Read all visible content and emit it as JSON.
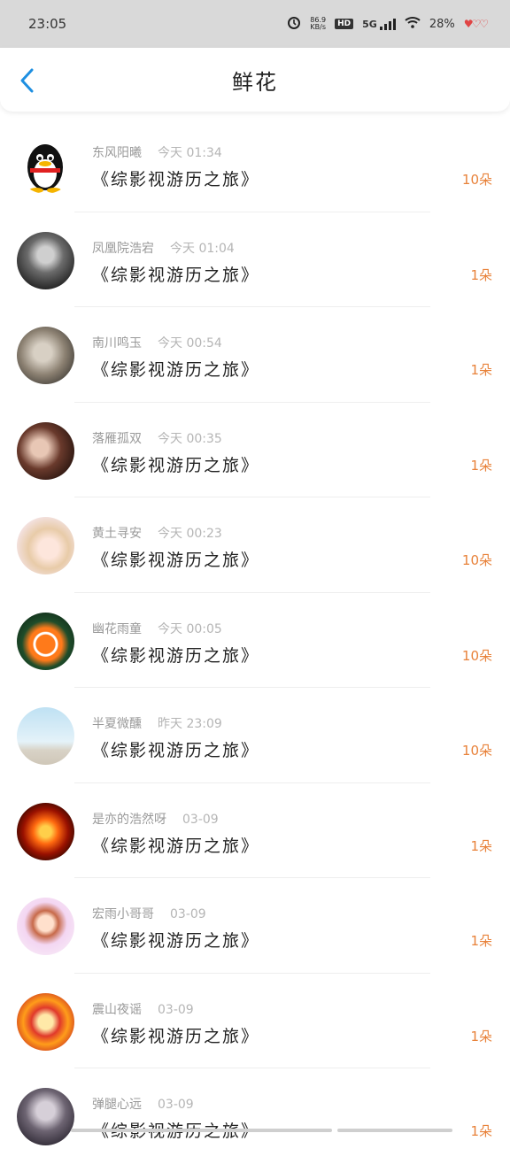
{
  "status": {
    "time": "23:05",
    "net_speed_top": "86.9",
    "net_speed_bottom": "KB/s",
    "hd": "HD",
    "network": "5G",
    "battery": "28%",
    "icons": [
      "alarm-icon",
      "hd-icon",
      "signal-icon",
      "wifi-icon",
      "battery-icon"
    ]
  },
  "header": {
    "title": "鲜花",
    "back_icon": "chevron-left-icon"
  },
  "items": [
    {
      "name": "东风阳曦",
      "time": "今天 01:34",
      "book": "《综影视游历之旅》",
      "count": "10朵"
    },
    {
      "name": "凤凰院浩宕",
      "time": "今天 01:04",
      "book": "《综影视游历之旅》",
      "count": "1朵"
    },
    {
      "name": "南川鸣玉",
      "time": "今天 00:54",
      "book": "《综影视游历之旅》",
      "count": "1朵"
    },
    {
      "name": "落雁孤双",
      "time": "今天 00:35",
      "book": "《综影视游历之旅》",
      "count": "1朵"
    },
    {
      "name": "黄土寻安",
      "time": "今天 00:23",
      "book": "《综影视游历之旅》",
      "count": "10朵"
    },
    {
      "name": "幽花雨童",
      "time": "今天 00:05",
      "book": "《综影视游历之旅》",
      "count": "10朵"
    },
    {
      "name": "半夏微醺",
      "time": "昨天 23:09",
      "book": "《综影视游历之旅》",
      "count": "10朵"
    },
    {
      "name": "是亦的浩然呀",
      "time": "03-09",
      "book": "《综影视游历之旅》",
      "count": "1朵"
    },
    {
      "name": "宏雨小哥哥",
      "time": "03-09",
      "book": "《综影视游历之旅》",
      "count": "1朵"
    },
    {
      "name": "震山夜谣",
      "time": "03-09",
      "book": "《综影视游历之旅》",
      "count": "1朵"
    },
    {
      "name": "弹腿心远",
      "time": "03-09",
      "book": "《综影视游历之旅》",
      "count": "1朵"
    }
  ],
  "colors": {
    "accent": "#1e8fe1",
    "count": "#e8823a"
  }
}
